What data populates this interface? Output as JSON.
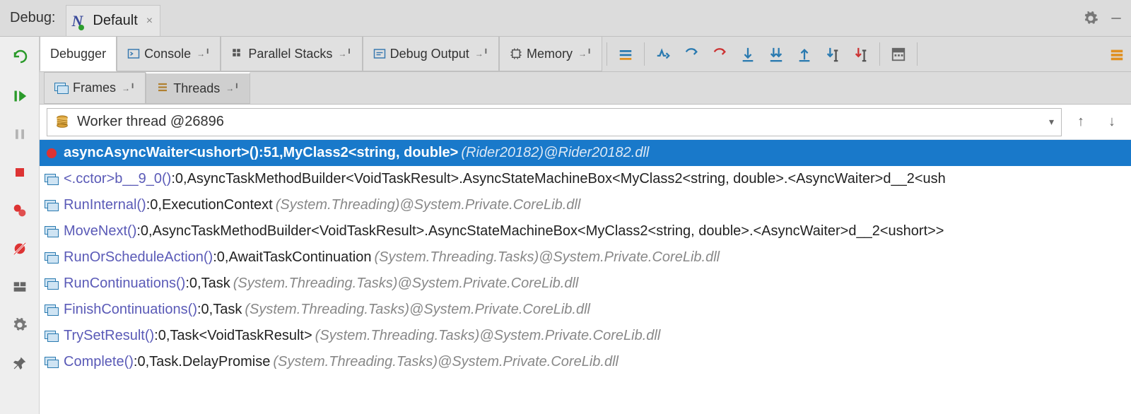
{
  "header": {
    "label": "Debug:",
    "config_name": "Default"
  },
  "toolbar": {
    "tabs": [
      {
        "id": "debugger",
        "label": "Debugger",
        "active": true,
        "icon": "none"
      },
      {
        "id": "console",
        "label": "Console",
        "icon": "console",
        "pin": true
      },
      {
        "id": "parallel",
        "label": "Parallel Stacks",
        "icon": "parallel",
        "pin": true
      },
      {
        "id": "debugout",
        "label": "Debug Output",
        "icon": "output",
        "pin": true
      },
      {
        "id": "memory",
        "label": "Memory",
        "icon": "memory",
        "pin": true
      }
    ]
  },
  "subtabs": [
    {
      "id": "frames",
      "label": "Frames",
      "pin": true,
      "active": false
    },
    {
      "id": "threads",
      "label": "Threads",
      "pin": true,
      "active": true
    }
  ],
  "thread_selector": "Worker thread @26896",
  "frames": [
    {
      "sel": true,
      "icon": "breakpoint",
      "prefix": "async ",
      "method": "AsyncWaiter<ushort>()",
      "loc": ":51, ",
      "type": "MyClass2<string, double>",
      "module": " (Rider20182)@Rider20182.dll"
    },
    {
      "icon": "stack",
      "method": "<.cctor>b__9_0()",
      "loc": ":0, ",
      "type": "AsyncTaskMethodBuilder<VoidTaskResult>.AsyncStateMachineBox<MyClass2<string, double>.<AsyncWaiter>d__2<ush",
      "module": ""
    },
    {
      "icon": "stack",
      "method": "RunInternal()",
      "loc": ":0, ",
      "type": "ExecutionContext",
      "module": " (System.Threading)@System.Private.CoreLib.dll"
    },
    {
      "icon": "stack",
      "method": "MoveNext()",
      "loc": ":0, ",
      "type": "AsyncTaskMethodBuilder<VoidTaskResult>.AsyncStateMachineBox<MyClass2<string, double>.<AsyncWaiter>d__2<ushort>>",
      "module": ""
    },
    {
      "icon": "stack",
      "method": "RunOrScheduleAction()",
      "loc": ":0, ",
      "type": "AwaitTaskContinuation",
      "module": " (System.Threading.Tasks)@System.Private.CoreLib.dll"
    },
    {
      "icon": "stack",
      "method": "RunContinuations()",
      "loc": ":0, ",
      "type": "Task",
      "module": " (System.Threading.Tasks)@System.Private.CoreLib.dll"
    },
    {
      "icon": "stack",
      "method": "FinishContinuations()",
      "loc": ":0, ",
      "type": "Task",
      "module": " (System.Threading.Tasks)@System.Private.CoreLib.dll"
    },
    {
      "icon": "stack",
      "method": "TrySetResult()",
      "loc": ":0, ",
      "type": "Task<VoidTaskResult>",
      "module": " (System.Threading.Tasks)@System.Private.CoreLib.dll"
    },
    {
      "icon": "stack",
      "method": "Complete()",
      "loc": ":0, ",
      "type": "Task.DelayPromise",
      "module": " (System.Threading.Tasks)@System.Private.CoreLib.dll"
    }
  ]
}
